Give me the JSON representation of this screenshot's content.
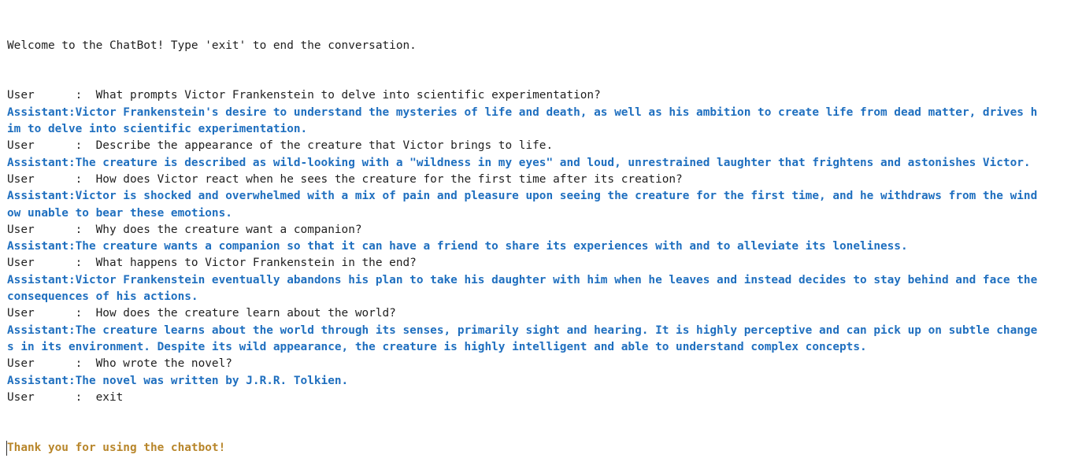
{
  "console": {
    "welcome": "Welcome to the ChatBot! Type 'exit' to end the conversation.",
    "thanks": "Thank you for using the chatbot!"
  },
  "lines": [
    {
      "kind": "user",
      "text": "User      :  What prompts Victor Frankenstein to delve into scientific experimentation?"
    },
    {
      "kind": "assistant",
      "text": "Assistant:Victor Frankenstein's desire to understand the mysteries of life and death, as well as his ambition to create life from dead matter, drives h"
    },
    {
      "kind": "cont",
      "text": "im to delve into scientific experimentation."
    },
    {
      "kind": "user",
      "text": "User      :  Describe the appearance of the creature that Victor brings to life."
    },
    {
      "kind": "assistant",
      "text": "Assistant:The creature is described as wild-looking with a \"wildness in my eyes\" and loud, unrestrained laughter that frightens and astonishes Victor."
    },
    {
      "kind": "user",
      "text": "User      :  How does Victor react when he sees the creature for the first time after its creation?"
    },
    {
      "kind": "assistant",
      "text": "Assistant:Victor is shocked and overwhelmed with a mix of pain and pleasure upon seeing the creature for the first time, and he withdraws from the wind"
    },
    {
      "kind": "cont",
      "text": "ow unable to bear these emotions."
    },
    {
      "kind": "user",
      "text": "User      :  Why does the creature want a companion?"
    },
    {
      "kind": "assistant",
      "text": "Assistant:The creature wants a companion so that it can have a friend to share its experiences with and to alleviate its loneliness."
    },
    {
      "kind": "user",
      "text": "User      :  What happens to Victor Frankenstein in the end?"
    },
    {
      "kind": "assistant",
      "text": "Assistant:Victor Frankenstein eventually abandons his plan to take his daughter with him when he leaves and instead decides to stay behind and face the"
    },
    {
      "kind": "cont",
      "text": "consequences of his actions."
    },
    {
      "kind": "user",
      "text": "User      :  How does the creature learn about the world?"
    },
    {
      "kind": "assistant",
      "text": "Assistant:The creature learns about the world through its senses, primarily sight and hearing. It is highly perceptive and can pick up on subtle change"
    },
    {
      "kind": "cont",
      "text": "s in its environment. Despite its wild appearance, the creature is highly intelligent and able to understand complex concepts."
    },
    {
      "kind": "user",
      "text": "User      :  Who wrote the novel?"
    },
    {
      "kind": "assistant",
      "text": "Assistant:The novel was written by J.R.R. Tolkien."
    },
    {
      "kind": "user",
      "text": "User      :  exit"
    }
  ]
}
